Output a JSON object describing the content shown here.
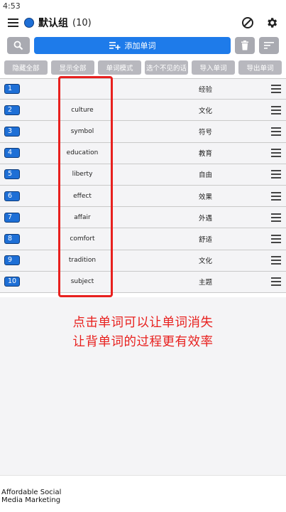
{
  "status_bar": {
    "time": "4:53"
  },
  "appbar": {
    "title": "默认组",
    "count": "(10)",
    "group_color": "#1e6fd6"
  },
  "toolbar": {
    "add_label": "添加单词"
  },
  "actions": [
    {
      "label": "隐藏全部"
    },
    {
      "label": "显示全部"
    },
    {
      "label": "单词模式"
    },
    {
      "label": "选个不见的话"
    },
    {
      "label": "导入单词"
    },
    {
      "label": "导出单词"
    }
  ],
  "words": [
    {
      "num": "1",
      "en": "",
      "cn": "经验"
    },
    {
      "num": "2",
      "en": "culture",
      "cn": "文化"
    },
    {
      "num": "3",
      "en": "symbol",
      "cn": "符号"
    },
    {
      "num": "4",
      "en": "education",
      "cn": "教育"
    },
    {
      "num": "5",
      "en": "liberty",
      "cn": "自由"
    },
    {
      "num": "6",
      "en": "effect",
      "cn": "效果"
    },
    {
      "num": "7",
      "en": "affair",
      "cn": "外遇"
    },
    {
      "num": "8",
      "en": "comfort",
      "cn": "舒适"
    },
    {
      "num": "9",
      "en": "tradition",
      "cn": "文化"
    },
    {
      "num": "10",
      "en": "subject",
      "cn": "主题"
    }
  ],
  "promo": {
    "line1": "点击单词可以让单词消失",
    "line2": "让背单词的过程更有效率"
  },
  "ad": {
    "text": "Affordable Social Media Marketing"
  },
  "colors": {
    "accent": "#1e7bea",
    "highlight": "#e8201e",
    "chip": "#b8b8be"
  }
}
